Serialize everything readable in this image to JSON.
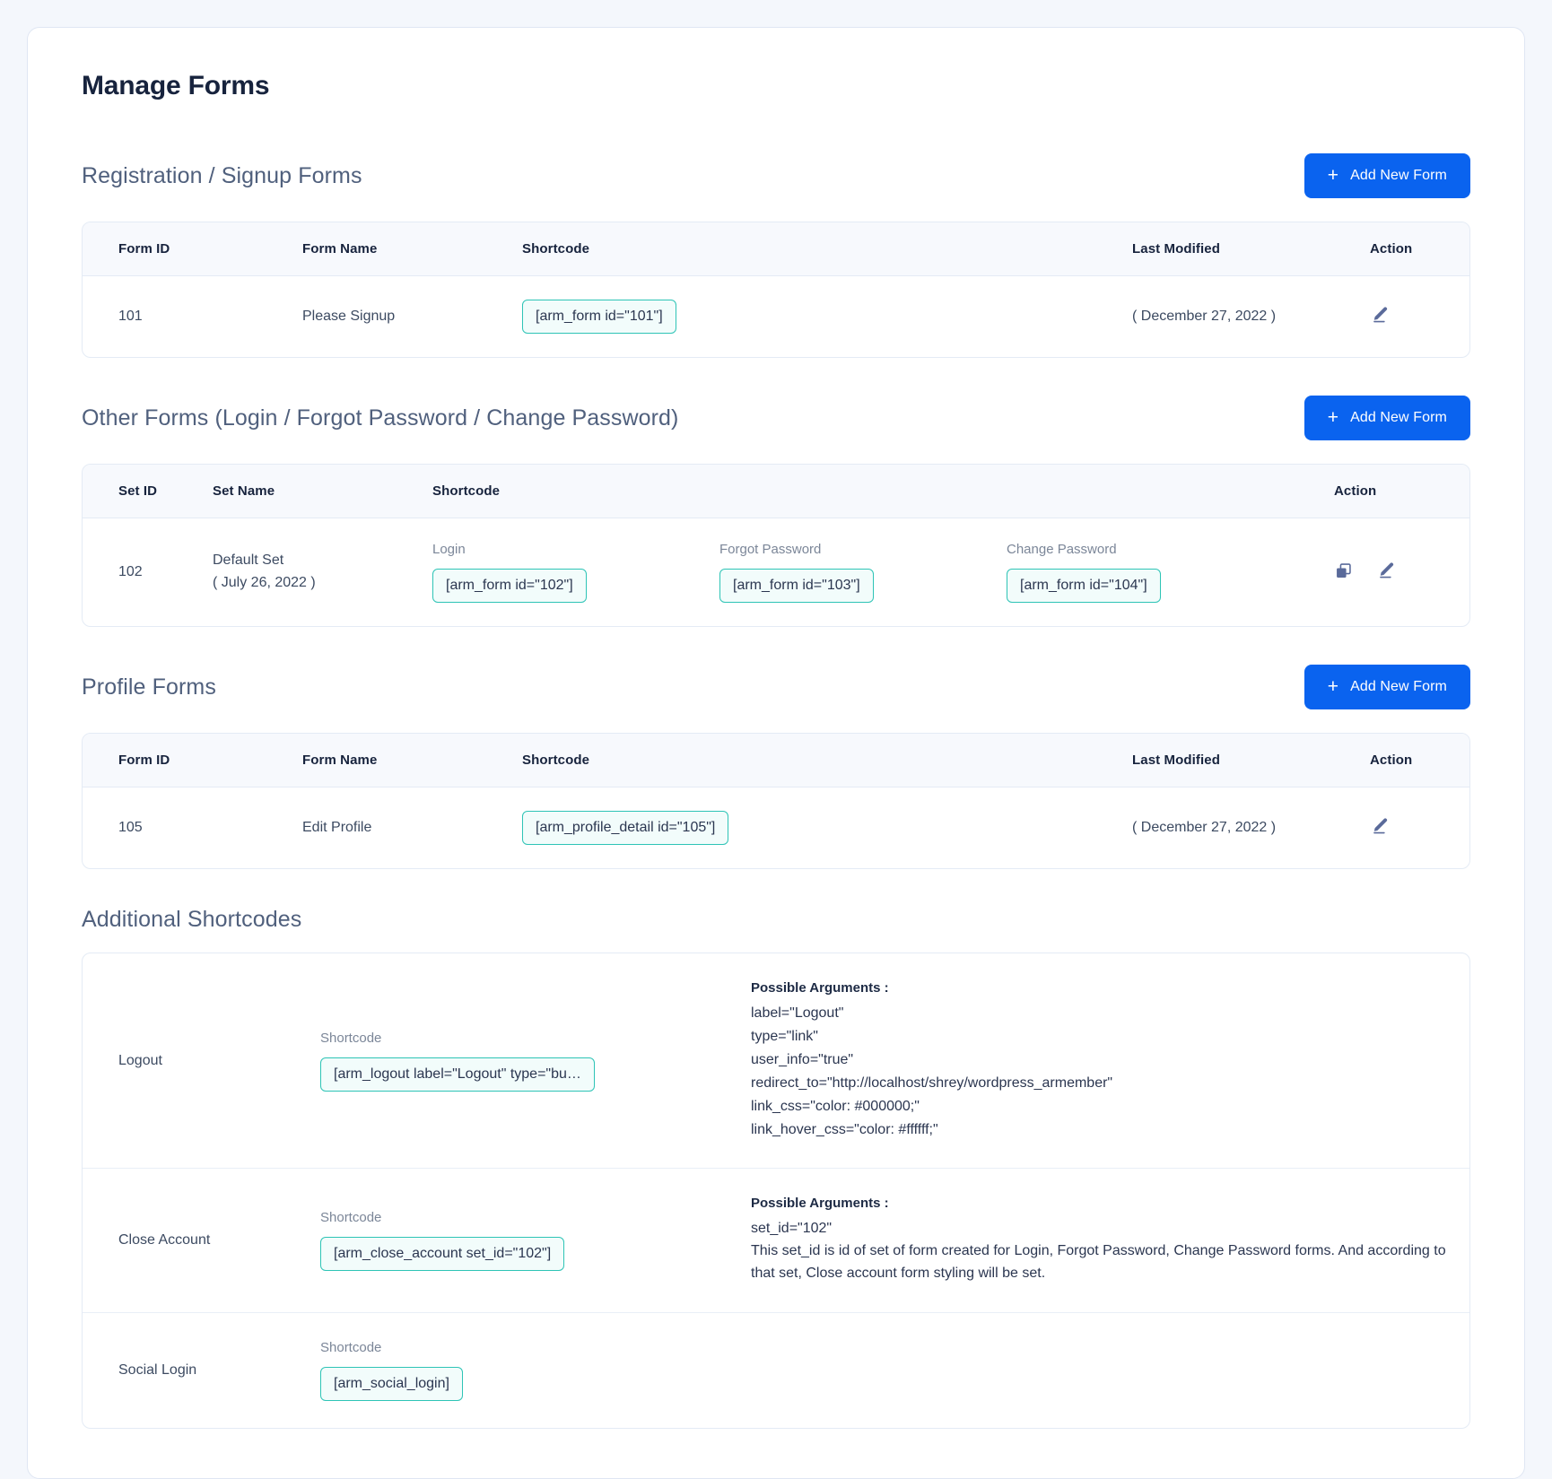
{
  "page": {
    "title": "Manage Forms"
  },
  "add_button_label": "Add New Form",
  "plus_glyph": "+",
  "sections": {
    "registration": {
      "title": "Registration / Signup Forms",
      "columns": [
        "Form ID",
        "Form Name",
        "Shortcode",
        "Last Modified",
        "Action"
      ],
      "rows": [
        {
          "form_id": "101",
          "form_name": "Please Signup",
          "shortcode": "[arm_form id=\"101\"]",
          "last_modified": "( December 27, 2022 )"
        }
      ]
    },
    "other_forms": {
      "title": "Other Forms (Login / Forgot Password / Change Password)",
      "columns": [
        "Set ID",
        "Set Name",
        "Shortcode",
        "Action"
      ],
      "rows": [
        {
          "set_id": "102",
          "set_name": "Default Set",
          "set_date": "( July 26, 2022 )",
          "shortcodes": [
            {
              "label": "Login",
              "code": "[arm_form id=\"102\"]"
            },
            {
              "label": "Forgot Password",
              "code": "[arm_form id=\"103\"]"
            },
            {
              "label": "Change Password",
              "code": "[arm_form id=\"104\"]"
            }
          ]
        }
      ]
    },
    "profile_forms": {
      "title": "Profile Forms",
      "columns": [
        "Form ID",
        "Form Name",
        "Shortcode",
        "Last Modified",
        "Action"
      ],
      "rows": [
        {
          "form_id": "105",
          "form_name": "Edit Profile",
          "shortcode": "[arm_profile_detail id=\"105\"]",
          "last_modified": "( December 27, 2022 )"
        }
      ]
    },
    "additional_shortcodes": {
      "title": "Additional Shortcodes",
      "shortcode_label": "Shortcode",
      "args_title": "Possible Arguments :",
      "rows": [
        {
          "name": "Logout",
          "shortcode": "[arm_logout label=\"Logout\" type=\"bu…",
          "args": [
            "label=\"Logout\"",
            "type=\"link\"",
            "user_info=\"true\"",
            "redirect_to=\"http://localhost/shrey/wordpress_armember\"",
            "link_css=\"color: #000000;\"",
            "link_hover_css=\"color: #ffffff;\""
          ],
          "description": ""
        },
        {
          "name": "Close Account",
          "shortcode": "[arm_close_account set_id=\"102\"]",
          "args": [
            "set_id=\"102\""
          ],
          "description": "This set_id is id of set of form created for Login, Forgot Password, Change Password forms. And according to that set, Close account form styling will be set."
        },
        {
          "name": "Social Login",
          "shortcode": "[arm_social_login]",
          "args": [],
          "description": ""
        }
      ]
    }
  },
  "colors": {
    "accent_blue": "#0a63ef",
    "code_border_teal": "#2ec4b6",
    "code_bg": "#f2fcfb",
    "title_navy": "#17233d",
    "icon_slate": "#5a6a9a",
    "page_bg": "#f4f7fc"
  }
}
